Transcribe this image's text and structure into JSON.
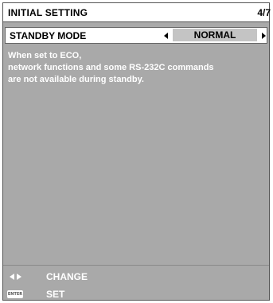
{
  "header": {
    "title": "INITIAL SETTING",
    "page": "4/7"
  },
  "setting": {
    "label": "STANDBY MODE",
    "value": "NORMAL"
  },
  "description": {
    "lines": [
      "When set to ECO,",
      "network functions and some RS-232C commands",
      "are not available during standby."
    ]
  },
  "footer": {
    "change_label": "CHANGE",
    "set_label": "SET",
    "enter_icon_text": "ENTER"
  },
  "colors": {
    "panel_background": "#a9a9a9",
    "header_background": "#ffffff",
    "value_background": "#c4c4c4",
    "text_on_panel": "#ffffff"
  },
  "icons": {
    "change": "left-right-arrows-icon",
    "set": "enter-key-icon",
    "value_prev": "arrow-left-icon",
    "value_next": "arrow-right-icon"
  }
}
